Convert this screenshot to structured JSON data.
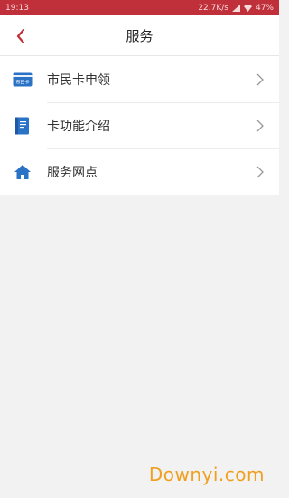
{
  "status": {
    "time": "19:13",
    "speed": "22.7K/s",
    "battery": "47%"
  },
  "header": {
    "title": "服务"
  },
  "menu": {
    "items": [
      {
        "label": "市民卡申领",
        "icon": "card-icon",
        "icon_text": "市民卡"
      },
      {
        "label": "卡功能介绍",
        "icon": "document-icon"
      },
      {
        "label": "服务网点",
        "icon": "home-icon"
      }
    ]
  },
  "watermark": "Downyi.com",
  "colors": {
    "status_bar": "#c0303a",
    "accent": "#c0303a",
    "icon_blue": "#2a72c6"
  }
}
